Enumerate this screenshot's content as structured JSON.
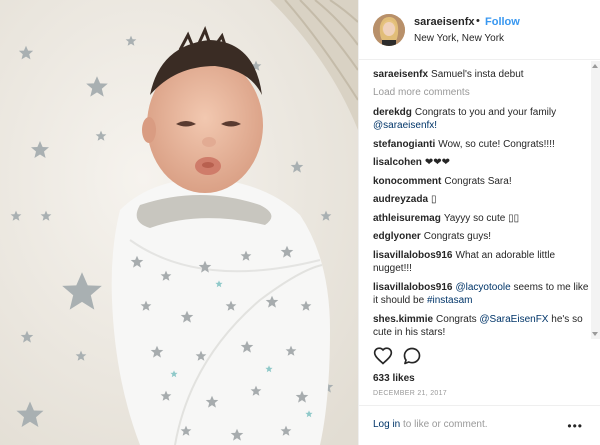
{
  "header": {
    "username": "saraeisenfx",
    "dot": "•",
    "follow_label": "Follow",
    "location": "New York, New York"
  },
  "comments": {
    "load_more": "Load more comments",
    "caption": {
      "user": "saraeisenfx",
      "text": "Samuel's insta debut"
    },
    "items": [
      {
        "user": "derekdg",
        "text": "Congrats to you and your family ",
        "mention": "@saraeisenfx!"
      },
      {
        "user": "stefanogianti",
        "text": "Wow, so cute! Congrats!!!!"
      },
      {
        "user": "lisalcohen",
        "text": "❤❤❤"
      },
      {
        "user": "konocomment",
        "text": "Congrats Sara!"
      },
      {
        "user": "audreyzada",
        "text": "▯"
      },
      {
        "user": "athleisuremag",
        "text": "Yayyy so cute ▯▯"
      },
      {
        "user": "edglyoner",
        "text": "Congrats guys!"
      },
      {
        "user": "lisavillalobos916",
        "text": "What an adorable little nugget!!!"
      },
      {
        "user": "lisavillalobos916",
        "mention": "@lacyotoole",
        "text": " seems to me like it should be ",
        "mention2": "#instasam"
      },
      {
        "user": "shes.kimmie",
        "text": "Congrats ",
        "mention": "@SaraEisenFX",
        "text2": " he's so cute in his stars!"
      }
    ]
  },
  "actions": {
    "like_icon": "heart-outline",
    "comment_icon": "speech-bubble-outline"
  },
  "likes": "633 likes",
  "date": "DECEMBER 21, 2017",
  "footer": {
    "login": "Log in",
    "rest": " to like or comment.",
    "more": "•••"
  },
  "colors": {
    "link": "#3897f0",
    "mention": "#003569",
    "muted": "#999999"
  }
}
